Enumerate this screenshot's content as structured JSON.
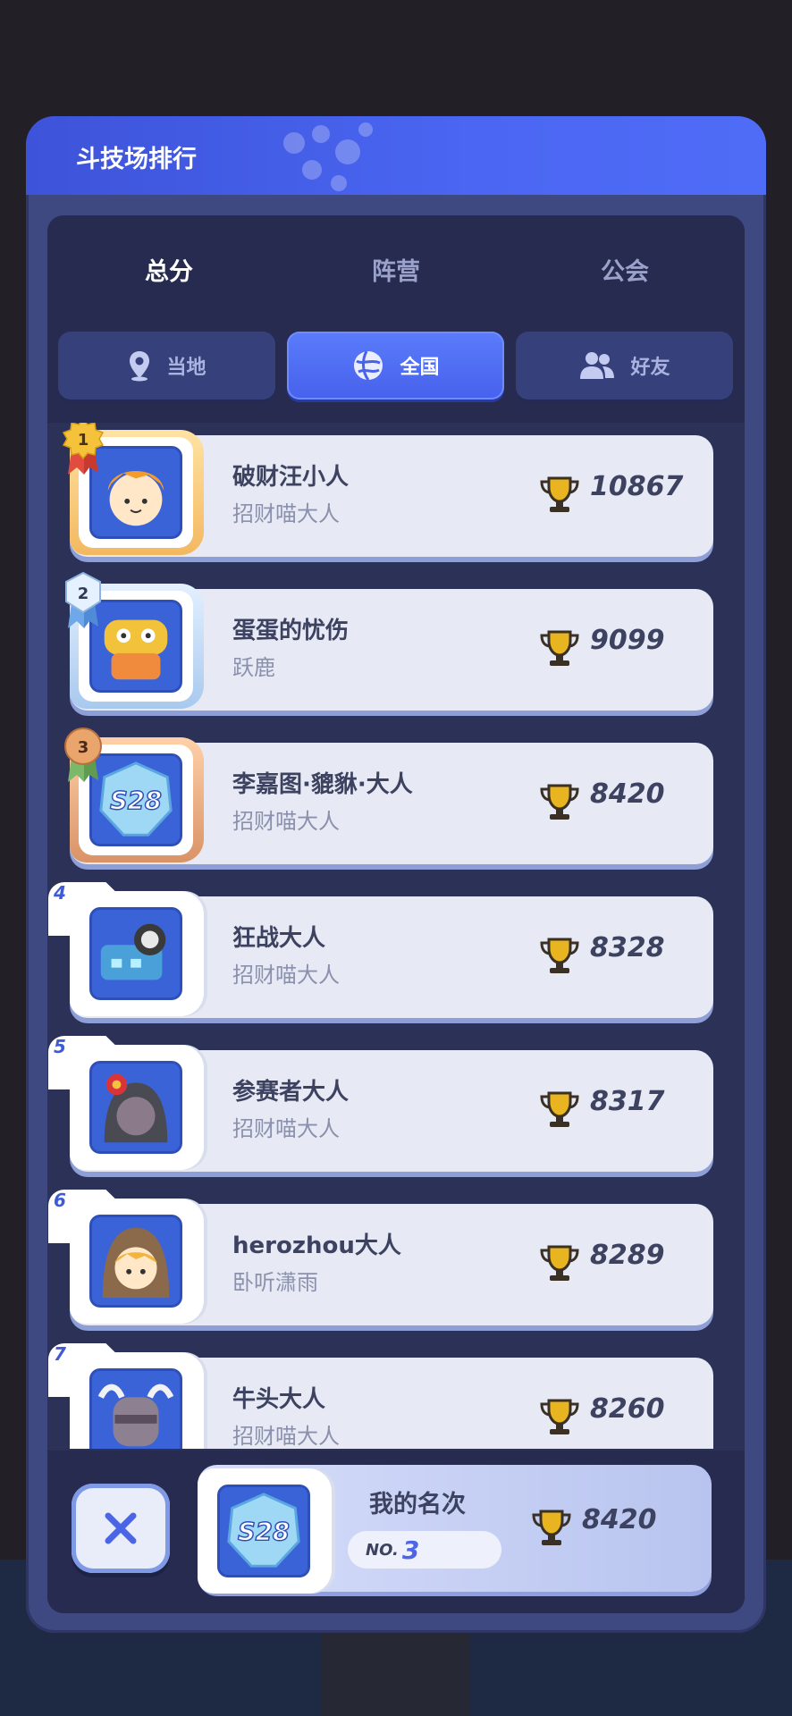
{
  "panel": {
    "title": "斗技场排行"
  },
  "tabs": {
    "main": [
      {
        "label": "总分",
        "active": true
      },
      {
        "label": "阵营",
        "active": false
      },
      {
        "label": "公会",
        "active": false
      }
    ],
    "sub": [
      {
        "label": "当地",
        "icon": "location-pin-icon",
        "active": false
      },
      {
        "label": "全国",
        "icon": "globe-icon",
        "active": true
      },
      {
        "label": "好友",
        "icon": "friends-icon",
        "active": false
      }
    ]
  },
  "list": [
    {
      "rank": "1",
      "name": "破财汪小人",
      "guild": "招财喵大人",
      "score": "10867",
      "tier": "gold"
    },
    {
      "rank": "2",
      "name": "蛋蛋的忧伤",
      "guild": "跃鹿",
      "score": "9099",
      "tier": "silver"
    },
    {
      "rank": "3",
      "name": "李嘉图·貔貅·大人",
      "guild": "招财喵大人",
      "score": "8420",
      "tier": "bronze"
    },
    {
      "rank": "4",
      "name": "狂战大人",
      "guild": "招财喵大人",
      "score": "8328",
      "tier": "plain"
    },
    {
      "rank": "5",
      "name": "参赛者大人",
      "guild": "招财喵大人",
      "score": "8317",
      "tier": "plain"
    },
    {
      "rank": "6",
      "name": "herozhou大人",
      "guild": "卧听潇雨",
      "score": "8289",
      "tier": "plain"
    },
    {
      "rank": "7",
      "name": "牛头大人",
      "guild": "招财喵大人",
      "score": "8260",
      "tier": "plain"
    }
  ],
  "my_rank": {
    "label": "我的名次",
    "no_prefix": "NO.",
    "rank": "3",
    "score": "8420",
    "avatar_text": "S28"
  },
  "colors": {
    "accent": "#4a66f2",
    "gold": "#f3b860",
    "silver": "#a8c9ee",
    "bronze": "#d99366",
    "trophy": "#e8b520"
  }
}
